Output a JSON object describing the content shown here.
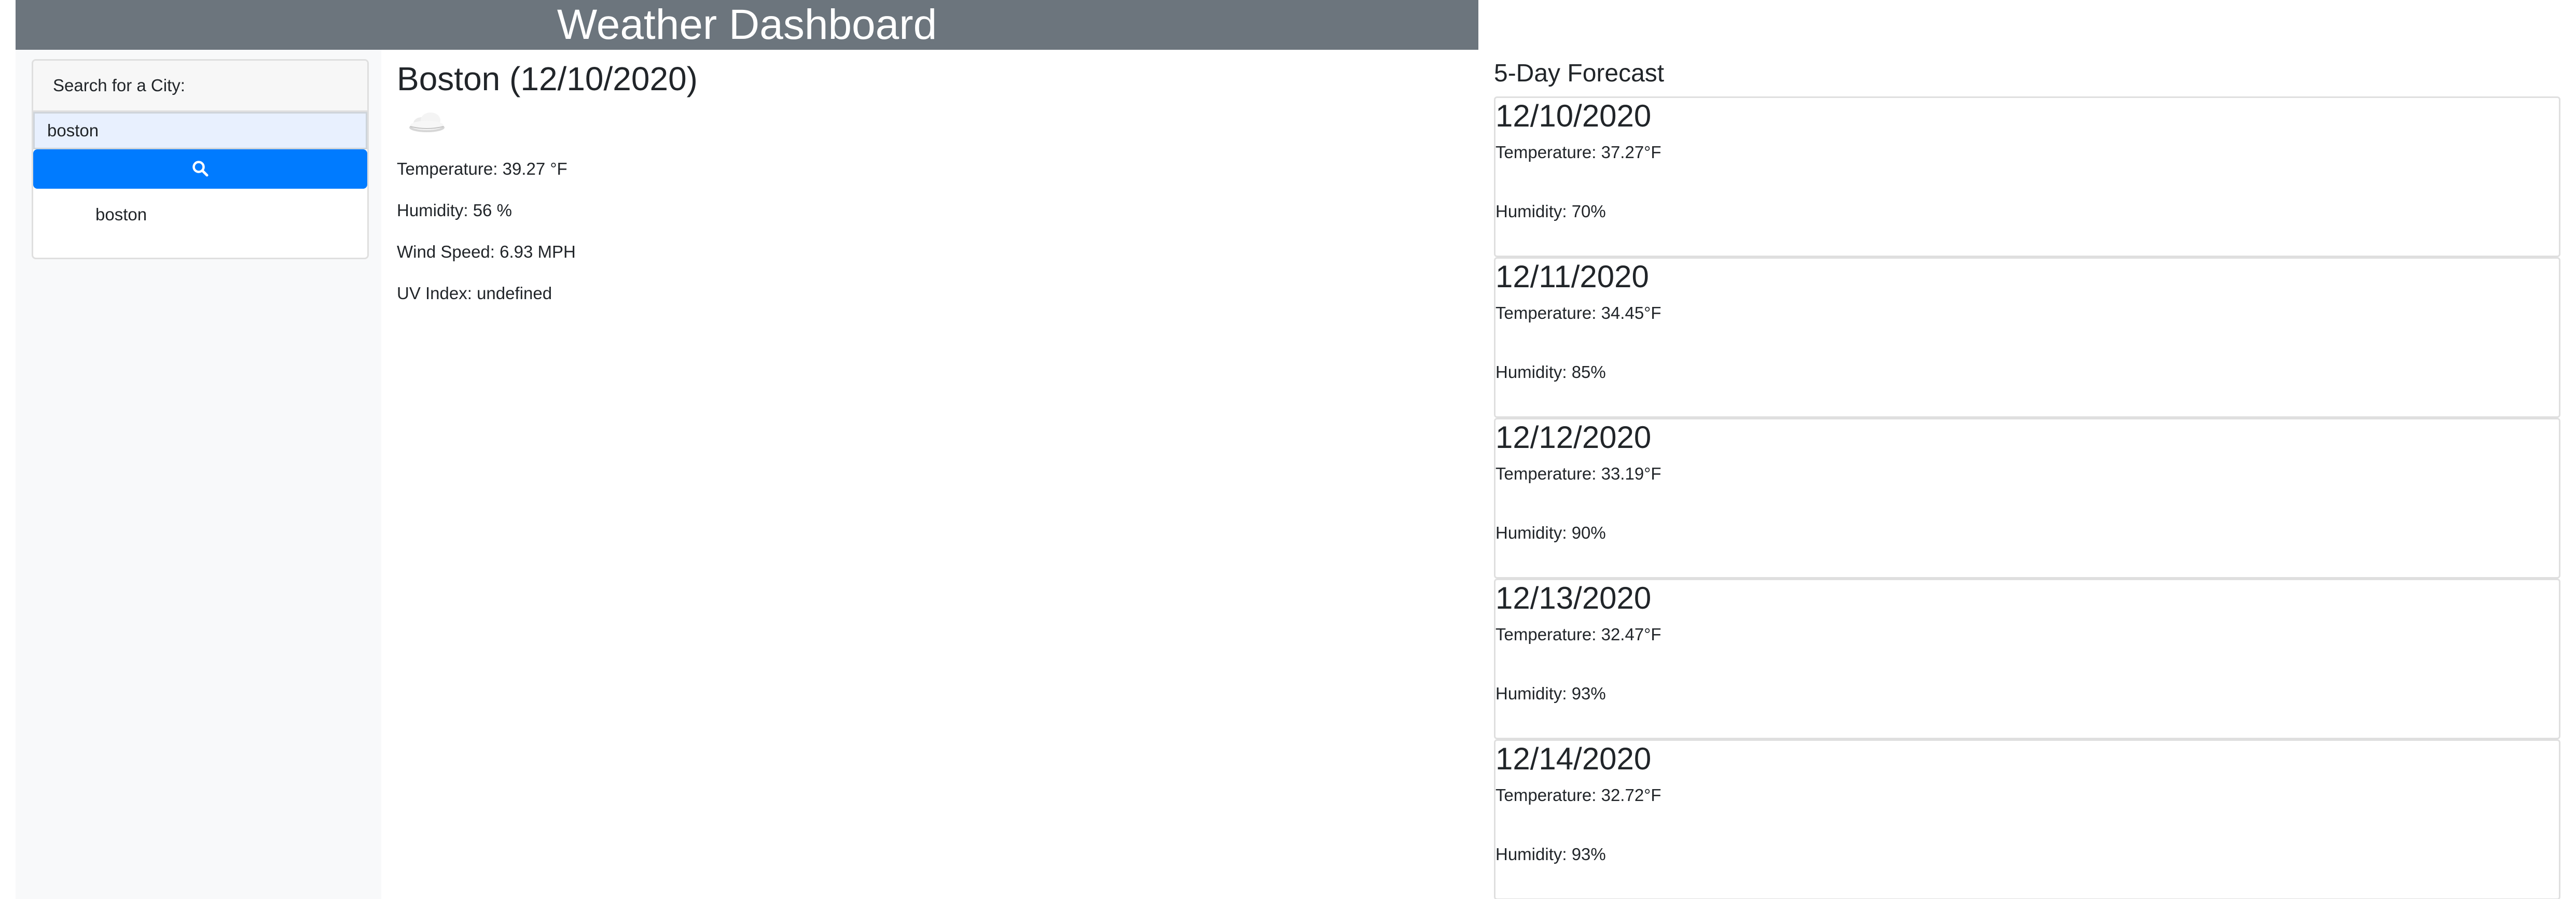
{
  "header": {
    "title": "Weather Dashboard"
  },
  "sidebar": {
    "search_label": "Search for a City:",
    "search_value": "boston",
    "search_button_icon": "search-icon",
    "history": [
      {
        "label": "boston"
      }
    ]
  },
  "current": {
    "title": "Boston (12/10/2020)",
    "icon": "cloud-icon",
    "temperature": "Temperature: 39.27 °F",
    "humidity": "Humidity: 56 %",
    "wind": "Wind Speed: 6.93 MPH",
    "uv": "UV Index: undefined"
  },
  "forecast": {
    "title": "5-Day Forecast",
    "days": [
      {
        "date": "12/10/2020",
        "temperature": "Temperature: 37.27°F",
        "humidity": "Humidity: 70%"
      },
      {
        "date": "12/11/2020",
        "temperature": "Temperature: 34.45°F",
        "humidity": "Humidity: 85%"
      },
      {
        "date": "12/12/2020",
        "temperature": "Temperature: 33.19°F",
        "humidity": "Humidity: 90%"
      },
      {
        "date": "12/13/2020",
        "temperature": "Temperature: 32.47°F",
        "humidity": "Humidity: 93%"
      },
      {
        "date": "12/14/2020",
        "temperature": "Temperature: 32.72°F",
        "humidity": "Humidity: 93%"
      }
    ]
  },
  "colors": {
    "header_bg": "#6c757d",
    "accent": "#007bff",
    "sidebar_bg": "#f8f9fa",
    "input_bg": "#e8f0fe"
  }
}
